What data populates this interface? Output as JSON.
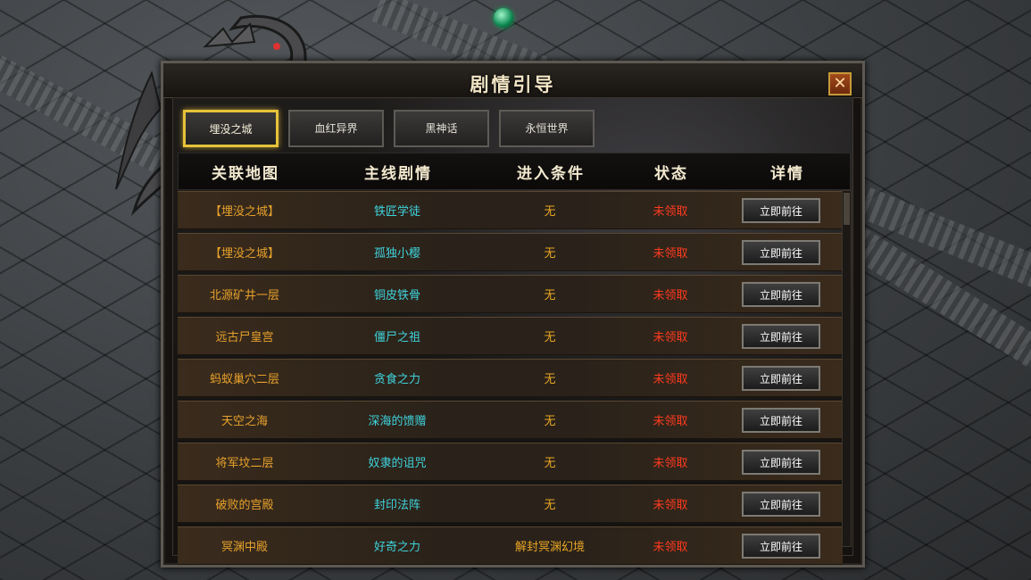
{
  "window": {
    "title": "剧情引导",
    "close_label": "✕"
  },
  "tabs": [
    {
      "label": "埋没之城",
      "active": true
    },
    {
      "label": "血红异界",
      "active": false
    },
    {
      "label": "黑神话",
      "active": false
    },
    {
      "label": "永恒世界",
      "active": false
    }
  ],
  "table": {
    "headers": [
      "关联地图",
      "主线剧情",
      "进入条件",
      "状态",
      "详情"
    ],
    "rows": [
      {
        "map": "【埋没之城】",
        "story": "铁匠学徒",
        "condition": "无",
        "status": "未领取",
        "button": "立即前往"
      },
      {
        "map": "【埋没之城】",
        "story": "孤独小樱",
        "condition": "无",
        "status": "未领取",
        "button": "立即前往"
      },
      {
        "map": "北源矿井一层",
        "story": "铜皮铁骨",
        "condition": "无",
        "status": "未领取",
        "button": "立即前往"
      },
      {
        "map": "远古尸皇宫",
        "story": "僵尸之祖",
        "condition": "无",
        "status": "未领取",
        "button": "立即前往"
      },
      {
        "map": "蚂蚁巢穴二层",
        "story": "贪食之力",
        "condition": "无",
        "status": "未领取",
        "button": "立即前往"
      },
      {
        "map": "天空之海",
        "story": "深海的馈赠",
        "condition": "无",
        "status": "未领取",
        "button": "立即前往"
      },
      {
        "map": "将军坟二层",
        "story": "奴隶的诅咒",
        "condition": "无",
        "status": "未领取",
        "button": "立即前往"
      },
      {
        "map": "破败的宫殿",
        "story": "封印法阵",
        "condition": "无",
        "status": "未领取",
        "button": "立即前往"
      },
      {
        "map": "冥渊中殿",
        "story": "好奇之力",
        "condition": "解封冥渊幻境",
        "status": "未领取",
        "button": "立即前往"
      }
    ]
  },
  "colors": {
    "map": "#e7a12b",
    "story": "#3fd3dc",
    "condition": "#e8a524",
    "status": "#ff3b1f",
    "active_tab_border": "#e6c23a"
  },
  "icons": [
    "close-icon",
    "dragon-ornament",
    "jewel-icon"
  ]
}
